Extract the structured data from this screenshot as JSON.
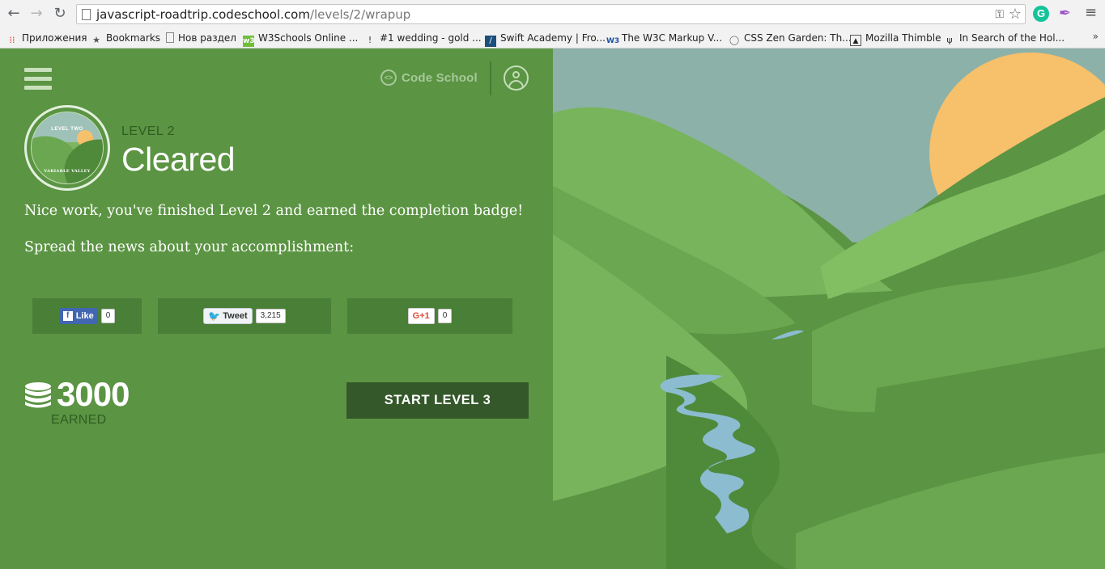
{
  "browser": {
    "url_host": "javascript-roadtrip.codeschool.com",
    "url_path": "/levels/2/wrapup",
    "bookmarks": [
      {
        "label": "Приложения",
        "icon": "apps-grid-icon"
      },
      {
        "label": "Bookmarks",
        "icon": "star-icon"
      },
      {
        "label": "Нов раздел",
        "icon": "page-icon"
      },
      {
        "label": "W3Schools Online ...",
        "icon": "w3schools-icon"
      },
      {
        "label": "#1 wedding - gold ...",
        "icon": "pin-icon"
      },
      {
        "label": "Swift Academy | Fro...",
        "icon": "swift-academy-icon"
      },
      {
        "label": "The W3C Markup V...",
        "icon": "w3c-icon"
      },
      {
        "label": "CSS Zen Garden: Th...",
        "icon": "zen-garden-icon"
      },
      {
        "label": "Mozilla Thimble",
        "icon": "thimble-icon"
      },
      {
        "label": "In Search of the Hol...",
        "icon": "laurel-icon"
      }
    ],
    "more": "»"
  },
  "header": {
    "brand": "Code School"
  },
  "badge": {
    "top_text": "LEVEL TWO",
    "bottom_text": "VARIABLE VALLEY"
  },
  "level": {
    "label": "LEVEL 2",
    "status": "Cleared"
  },
  "messages": {
    "finished": "Nice work, you've finished Level 2 and earned the completion badge!",
    "spread": "Spread the news about your accomplishment:"
  },
  "share": {
    "facebook": {
      "label": "Like",
      "count": "0"
    },
    "twitter": {
      "label": "Tweet",
      "count": "3,215"
    },
    "google": {
      "label": "G+1",
      "count": "0"
    }
  },
  "points": {
    "value": "3000",
    "label": "EARNED"
  },
  "actions": {
    "next_level": "START LEVEL 3"
  },
  "colors": {
    "panel_green": "#5b9443",
    "button_dark": "#34582a",
    "sky": "#8cb1a8",
    "sun": "#f7c06a",
    "river": "#8cbcd0"
  }
}
